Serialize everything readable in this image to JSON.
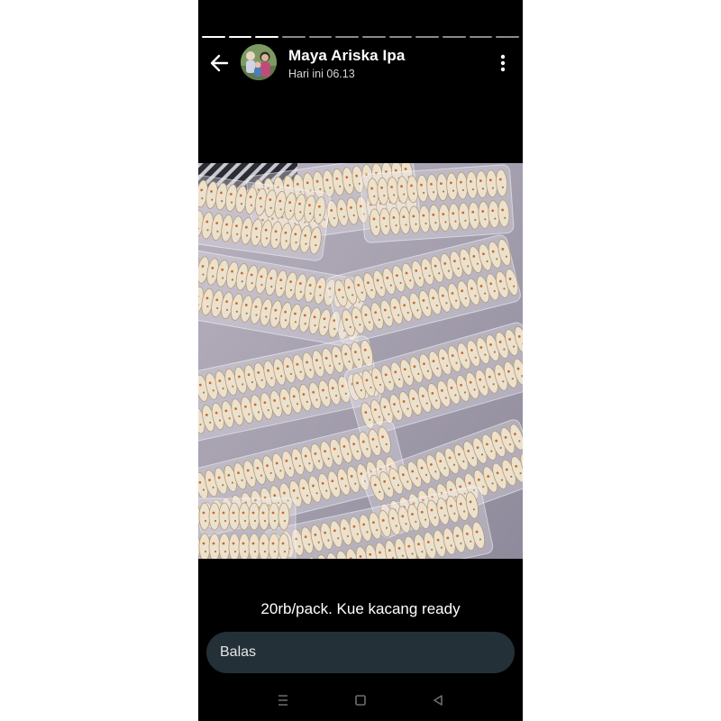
{
  "story": {
    "segments_total": 12,
    "segments_viewed": 3
  },
  "header": {
    "contact_name": "Maya Ariska Ipa",
    "timestamp": "Hari ini 06.13",
    "back_icon": "arrow-left-icon",
    "menu_icon": "more-vertical-icon"
  },
  "status": {
    "caption": "20rb/pack. Kue kacang ready"
  },
  "reply": {
    "label": "Balas"
  },
  "navbar": {
    "recents_icon": "menu-lines-icon",
    "home_icon": "square-icon",
    "back_icon": "triangle-back-icon"
  },
  "colors": {
    "background": "#000000",
    "reply_bar": "#243038",
    "text_primary": "#ffffff",
    "text_secondary": "#d6d6d6",
    "nav_icons": "#6e6e6e"
  }
}
